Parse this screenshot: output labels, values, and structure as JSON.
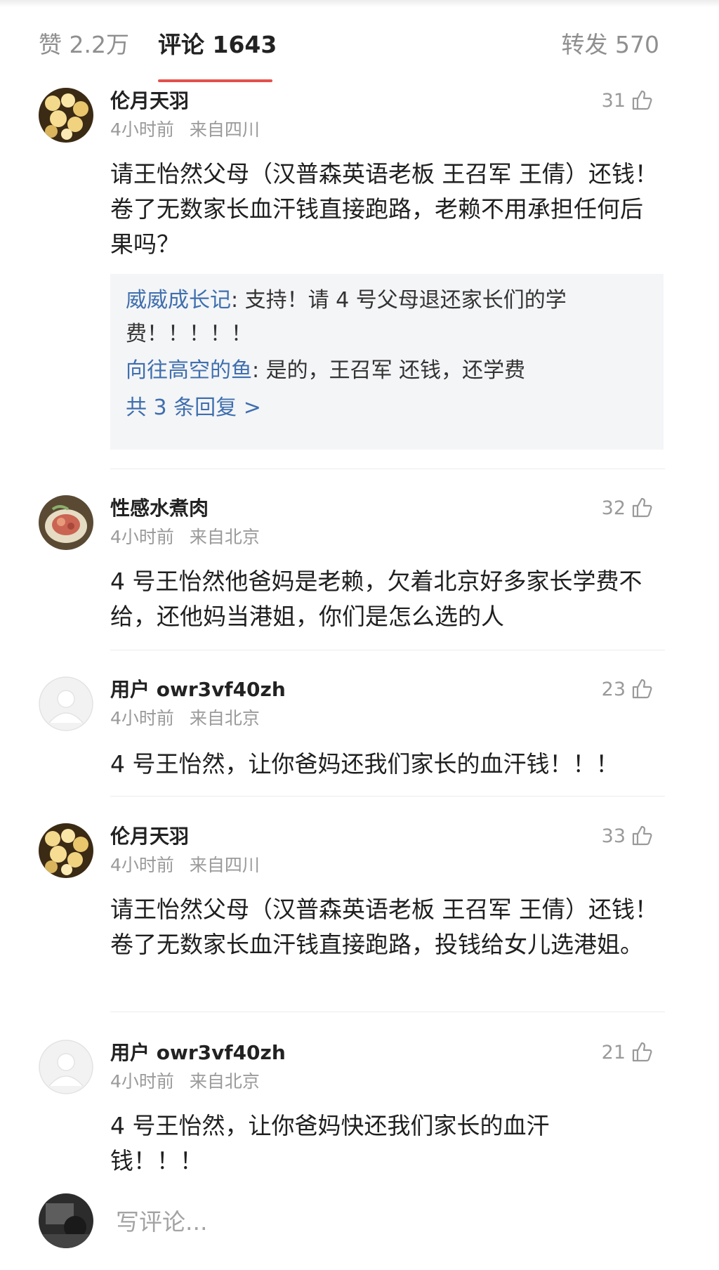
{
  "tabs": {
    "likes": "赞 2.2万",
    "comments": "评论 1643",
    "reposts": "转发 570"
  },
  "comments": [
    {
      "user": "伦月天羽",
      "time": "4小时前",
      "location": "来自四川",
      "likes": "31",
      "avatar_icon": "golden-beads-avatar",
      "text": "请王怡然父母（汉普森英语老板 王召军 王倩）还钱！卷了无数家长血汗钱直接跑路，老赖不用承担任何后果吗？",
      "replies": [
        {
          "name": "威威成长记",
          "text": ": 支持！请 4 号父母退还家长们的学费！！！！！"
        },
        {
          "name": "向往高空的鱼",
          "text": ": 是的，王召军 还钱，还学费"
        }
      ],
      "more_replies": "共 3 条回复 >"
    },
    {
      "user": "性感水煮肉",
      "time": "4小时前",
      "location": "来自北京",
      "likes": "32",
      "avatar_icon": "food-plate-avatar",
      "text": "4 号王怡然他爸妈是老赖，欠着北京好多家长学费不给，还他妈当港姐，你们是怎么选的人"
    },
    {
      "user": "用户 owr3vf40zh",
      "time": "4小时前",
      "location": "来自北京",
      "likes": "23",
      "avatar_icon": "default-user-avatar",
      "text": "4 号王怡然，让你爸妈还我们家长的血汗钱！！！"
    },
    {
      "user": "伦月天羽",
      "time": "4小时前",
      "location": "来自四川",
      "likes": "33",
      "avatar_icon": "golden-beads-avatar",
      "text": "请王怡然父母（汉普森英语老板 王召军 王倩）还钱！卷了无数家长血汗钱直接跑路，投钱给女儿选港姐。"
    },
    {
      "user": "用户 owr3vf40zh",
      "time": "4小时前",
      "location": "来自北京",
      "likes": "21",
      "avatar_icon": "default-user-avatar",
      "text": "4 号王怡然，让你爸妈快还我们家长的血汗钱！！！"
    }
  ],
  "composer": {
    "placeholder": "写评论...",
    "avatar_icon": "dark-photo-avatar"
  },
  "colors": {
    "accent": "#e4514b",
    "link": "#3f6fae",
    "meta": "#9a9a9a",
    "reply_bg": "#f4f5f7"
  }
}
